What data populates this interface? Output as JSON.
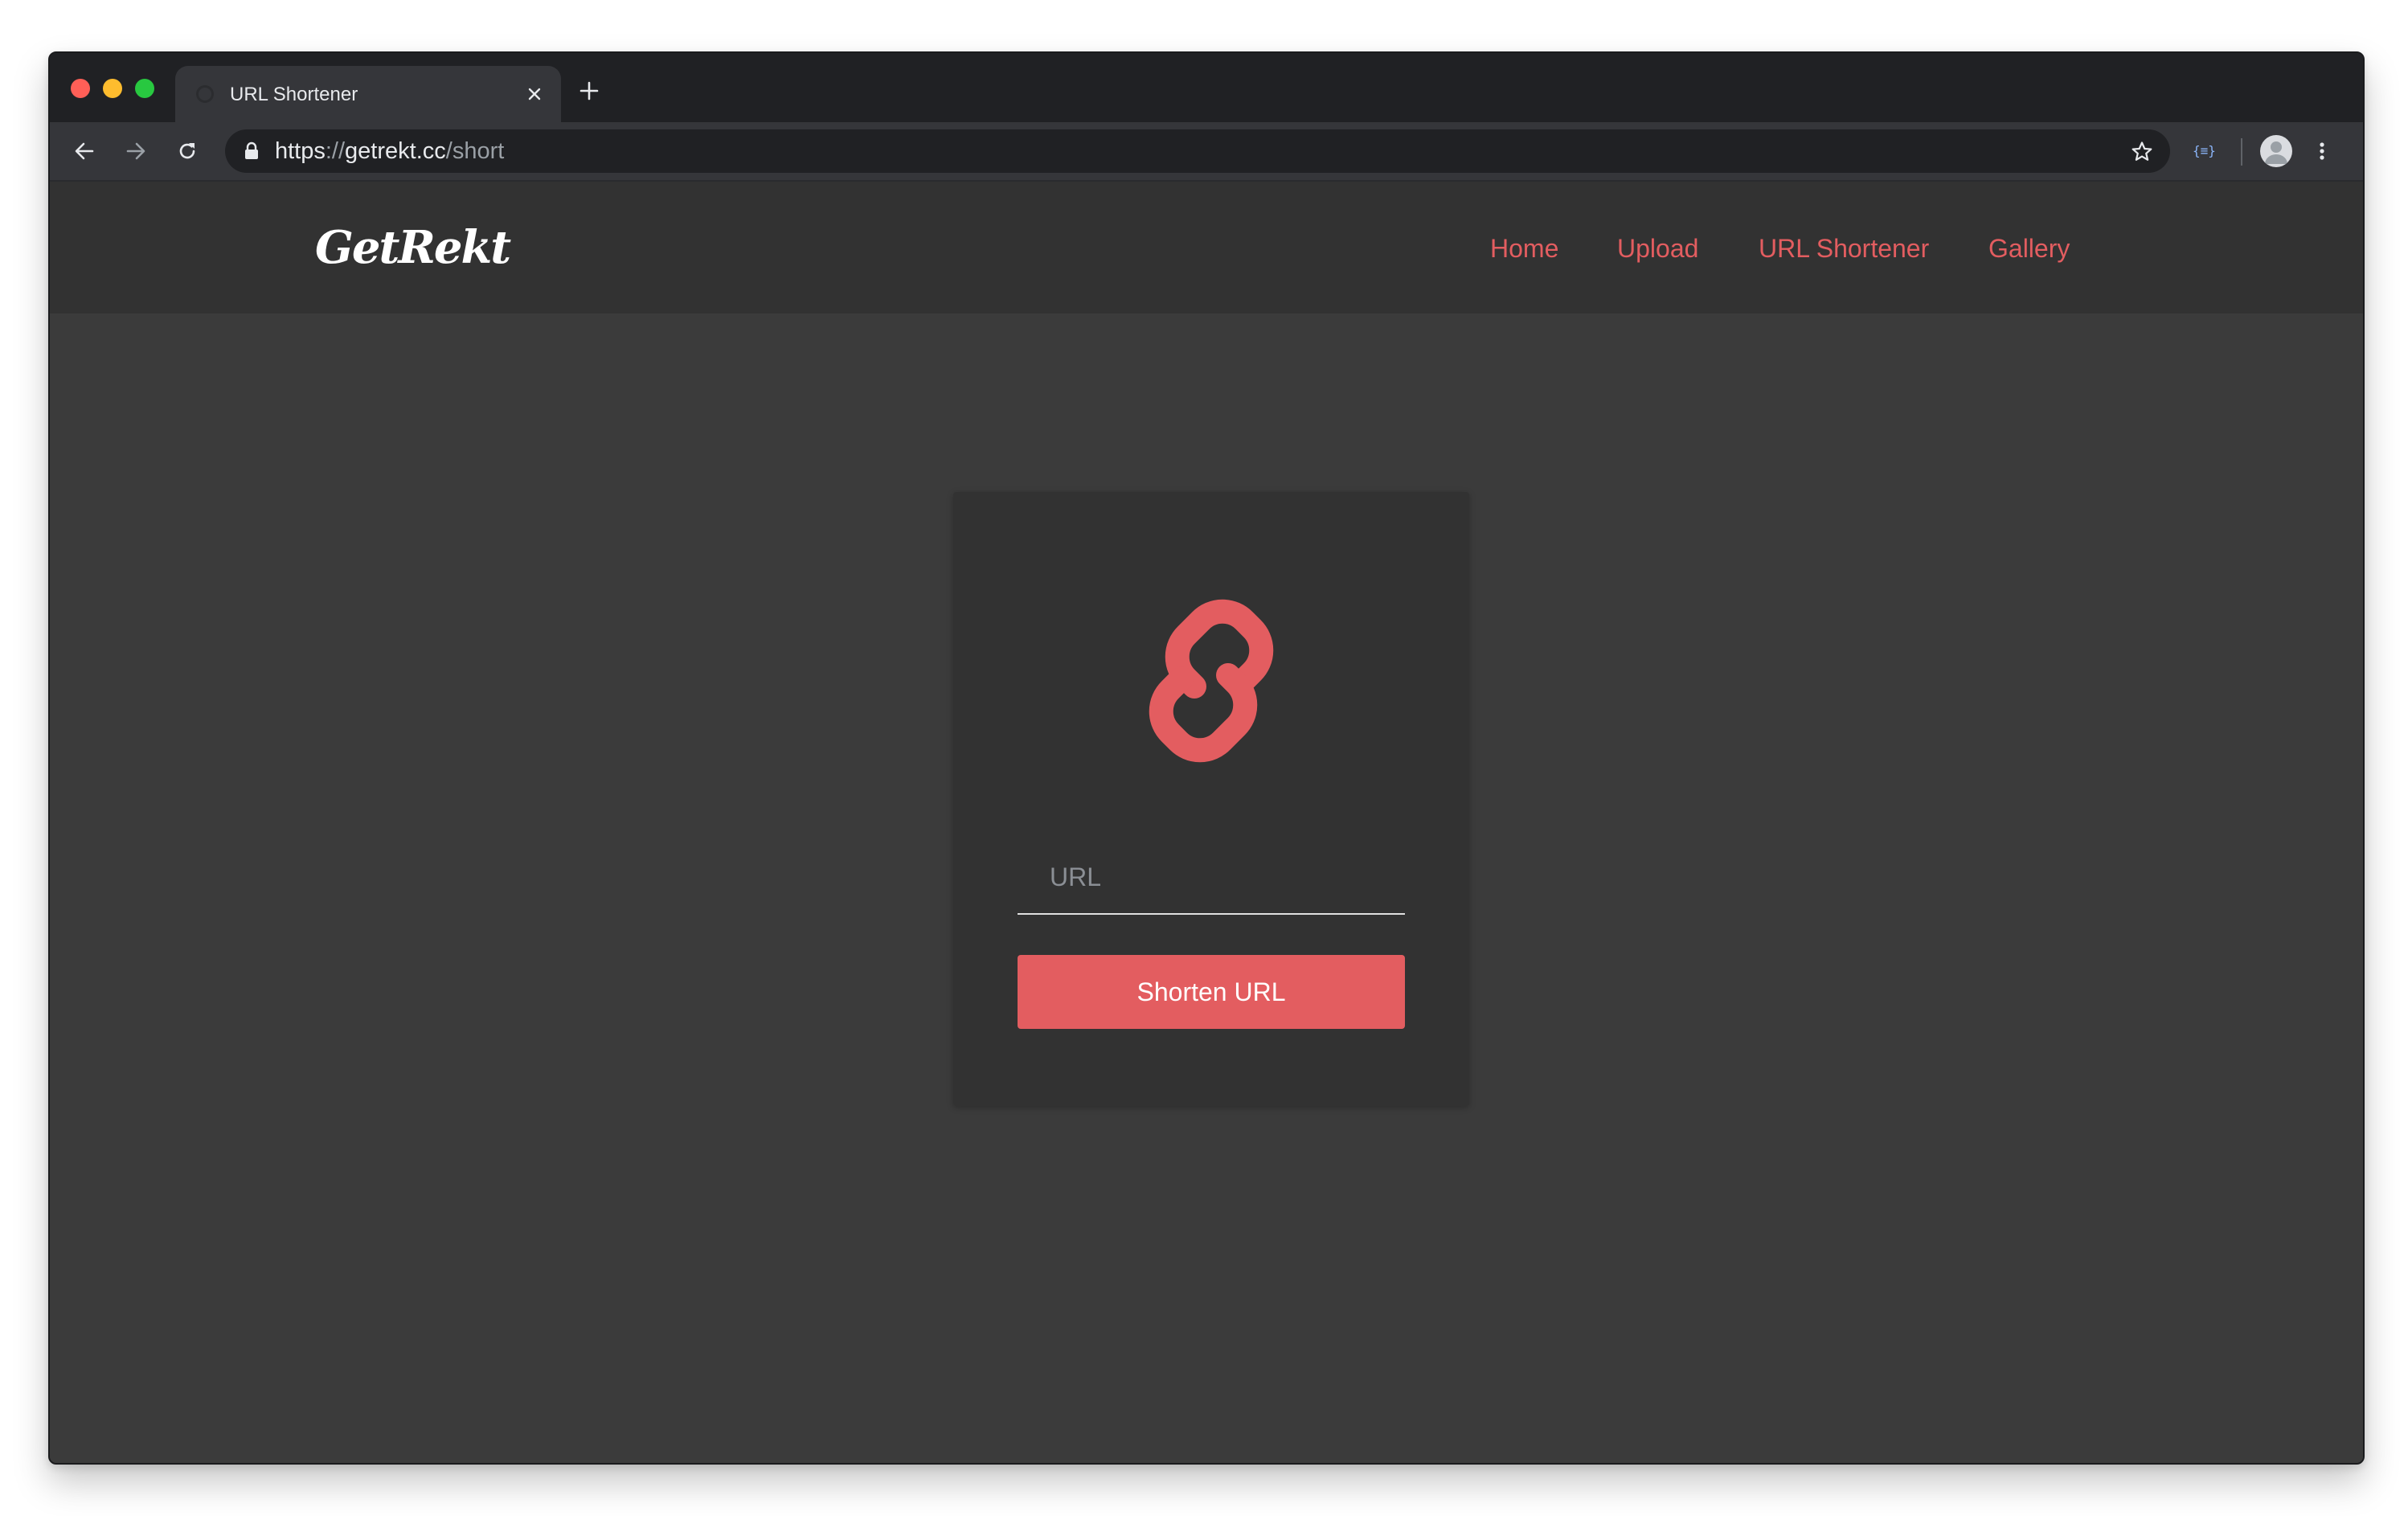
{
  "browser": {
    "tab": {
      "title": "URL Shortener"
    },
    "address_bar": {
      "scheme": "https",
      "separator": "://",
      "host": "getrekt.cc",
      "path": "/short"
    },
    "extension_label": "{≡}"
  },
  "site": {
    "brand": "GetRekt",
    "nav": [
      {
        "label": "Home"
      },
      {
        "label": "Upload"
      },
      {
        "label": "URL Shortener"
      },
      {
        "label": "Gallery"
      }
    ]
  },
  "shortener": {
    "icon": "link-icon",
    "input": {
      "placeholder": "URL",
      "value": ""
    },
    "button_label": "Shorten URL"
  },
  "colors": {
    "accent": "#e35d60",
    "page_background": "#3b3b3b",
    "navbar_background": "#323232",
    "card_background": "#323232"
  }
}
